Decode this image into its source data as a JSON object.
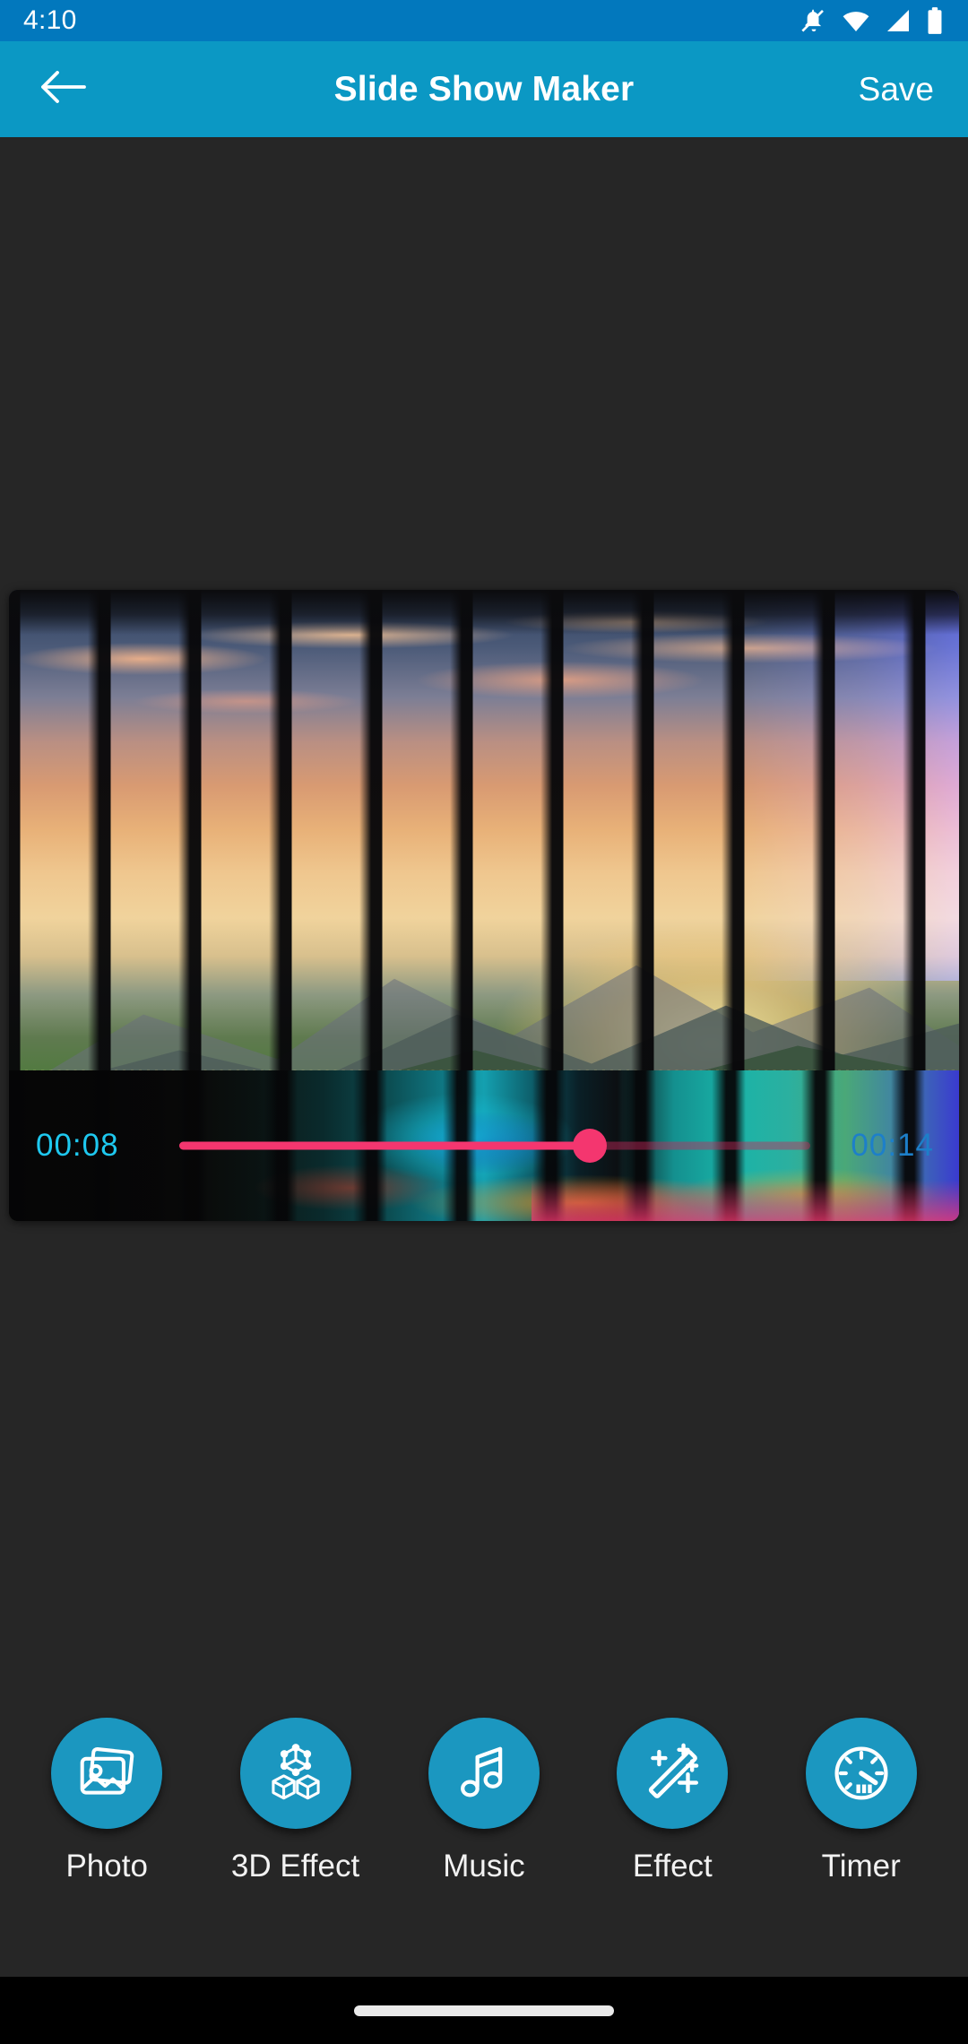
{
  "status_bar": {
    "time": "4:10",
    "icons": [
      {
        "name": "notifications-off-icon",
        "label": "notifications off"
      },
      {
        "name": "wifi-icon",
        "label": "wifi"
      },
      {
        "name": "cellular-signal-icon",
        "label": "cellular signal"
      },
      {
        "name": "battery-icon",
        "label": "battery full"
      }
    ],
    "background_color": "#0278bd"
  },
  "app_bar": {
    "back_icon": "arrow-back-icon",
    "title": "Slide Show Maker",
    "save_label": "Save",
    "background_color": "#0b98c4",
    "text_color": "#ffffff"
  },
  "preview": {
    "description": "sunset mountain landscape with vertical blinds slide transition",
    "background_color": "#262626"
  },
  "timeline": {
    "current_time": "00:08",
    "total_time": "00:14",
    "current_time_color": "#1ec8ef",
    "total_time_color": "#1d7fc9",
    "progress_percent": 65,
    "track_color": "#f4366f",
    "track_bg_color": "rgba(200,40,90,.45)",
    "thumb_color": "#f4366f"
  },
  "toolbar": {
    "accent_color": "#1b97c0",
    "items": [
      {
        "label": "Photo",
        "icon": "photo-stack-icon"
      },
      {
        "label": "3D Effect",
        "icon": "cubes-3d-icon"
      },
      {
        "label": "Music",
        "icon": "music-note-icon"
      },
      {
        "label": "Effect",
        "icon": "magic-wand-icon"
      },
      {
        "label": "Timer",
        "icon": "clock-timer-icon"
      }
    ]
  },
  "navigation_bar": {
    "home_indicator": "home-pill-indicator",
    "background_color": "#000000"
  }
}
